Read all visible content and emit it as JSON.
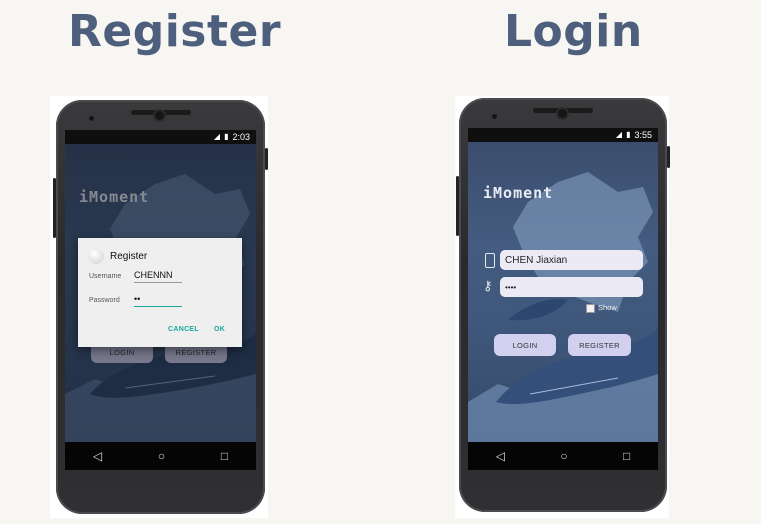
{
  "headings": {
    "register": "Register",
    "login": "Login"
  },
  "register_phone": {
    "status": {
      "signal_icon": "signal-icon",
      "battery_icon": "battery-icon",
      "time": "2:03"
    },
    "logo": "iMoment",
    "background_buttons": {
      "login": "LOGIN",
      "register": "REGISTER"
    },
    "dialog": {
      "title": "Register",
      "username_label": "Username",
      "username_value": "CHENNN",
      "password_label": "Password",
      "password_value": "••",
      "cancel": "CANCEL",
      "ok": "OK"
    }
  },
  "login_phone": {
    "status": {
      "signal_icon": "signal-icon",
      "battery_icon": "battery-icon",
      "time": "3:55"
    },
    "logo": "iMoment",
    "username_value": "CHEN Jiaxian",
    "password_value": "••••",
    "show_label": "Show",
    "login_button": "LOGIN",
    "register_button": "REGISTER"
  },
  "nav": {
    "back": "◁",
    "home": "○",
    "recent": "□"
  },
  "colors": {
    "heading": "#4e5f7e",
    "accent": "#1ba89a",
    "button": "#d2d0ee",
    "field": "#eceaf4"
  }
}
